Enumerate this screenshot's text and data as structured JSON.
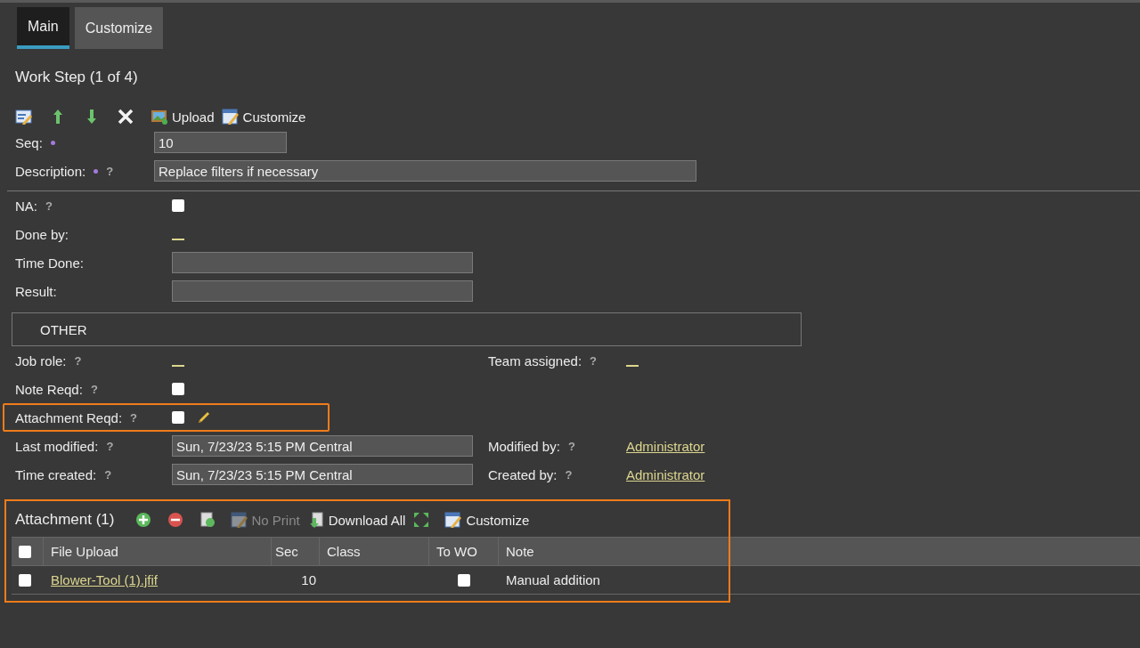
{
  "tabs": [
    {
      "label": "Main",
      "selected": true
    },
    {
      "label": "Customize",
      "selected": false
    }
  ],
  "title": "Work Step (1 of 4)",
  "toolbar": [
    {
      "kind": "edit"
    },
    {
      "kind": "up"
    },
    {
      "kind": "down"
    },
    {
      "kind": "delete"
    },
    {
      "kind": "upload",
      "label": "Upload"
    },
    {
      "kind": "customize",
      "label": "Customize"
    }
  ],
  "top_fields": [
    {
      "label": "Seq:",
      "required": true,
      "kind": "input",
      "value": "10"
    },
    {
      "label": "Description:",
      "required": true,
      "help": "?",
      "kind": "input",
      "value": "Replace filters if necessary"
    }
  ],
  "fields": [
    {
      "label": "NA:",
      "help": "?",
      "kind": "checkbox",
      "checked": false
    },
    {
      "label": "Done by:",
      "kind": "empty-link"
    },
    {
      "label": "Time Done:",
      "kind": "input"
    },
    {
      "label": "Result:",
      "kind": "input"
    }
  ],
  "other_header": "OTHER",
  "other_rows": [
    {
      "left": {
        "label": "Job role:",
        "help": "?",
        "kind": "empty-link"
      },
      "right": {
        "label": "Team assigned:",
        "help": "?",
        "kind": "empty-link"
      }
    },
    {
      "left": {
        "label": "Note Reqd:",
        "help": "?",
        "kind": "checkbox",
        "checked": false
      }
    },
    {
      "left": {
        "label": "Attachment Reqd:",
        "help": "?",
        "kind": "checkbox",
        "checked": false,
        "edit_icon": true,
        "highlighted": true
      }
    },
    {
      "left": {
        "label": "Last modified:",
        "help": "?",
        "kind": "input",
        "value": "Sun, 7/23/23 5:15 PM Central"
      },
      "right": {
        "label": "Modified by:",
        "help": "?",
        "kind": "link",
        "value": "Administrator"
      }
    },
    {
      "left": {
        "label": "Time created:",
        "help": "?",
        "kind": "input",
        "value": "Sun, 7/23/23 5:15 PM Central"
      },
      "right": {
        "label": "Created by:",
        "help": "?",
        "kind": "link",
        "value": "Administrator"
      }
    }
  ],
  "attachment": {
    "title": "Attachment (1)",
    "highlighted": true,
    "toolbar": [
      {
        "kind": "add"
      },
      {
        "kind": "remove"
      },
      {
        "kind": "refresh"
      },
      {
        "kind": "print",
        "label": "No Print",
        "disabled": true
      },
      {
        "kind": "download",
        "label": "Download All"
      },
      {
        "kind": "expand"
      },
      {
        "kind": "customize",
        "label": "Customize"
      }
    ],
    "header_checked": false,
    "columns": [
      "File Upload",
      "Sec",
      "Class",
      "To WO",
      "Note"
    ],
    "rows": [
      {
        "checked": false,
        "file": "Blower-Tool (1).jfif",
        "seq": "10",
        "to_wo": false,
        "note": "Manual addition"
      }
    ]
  }
}
